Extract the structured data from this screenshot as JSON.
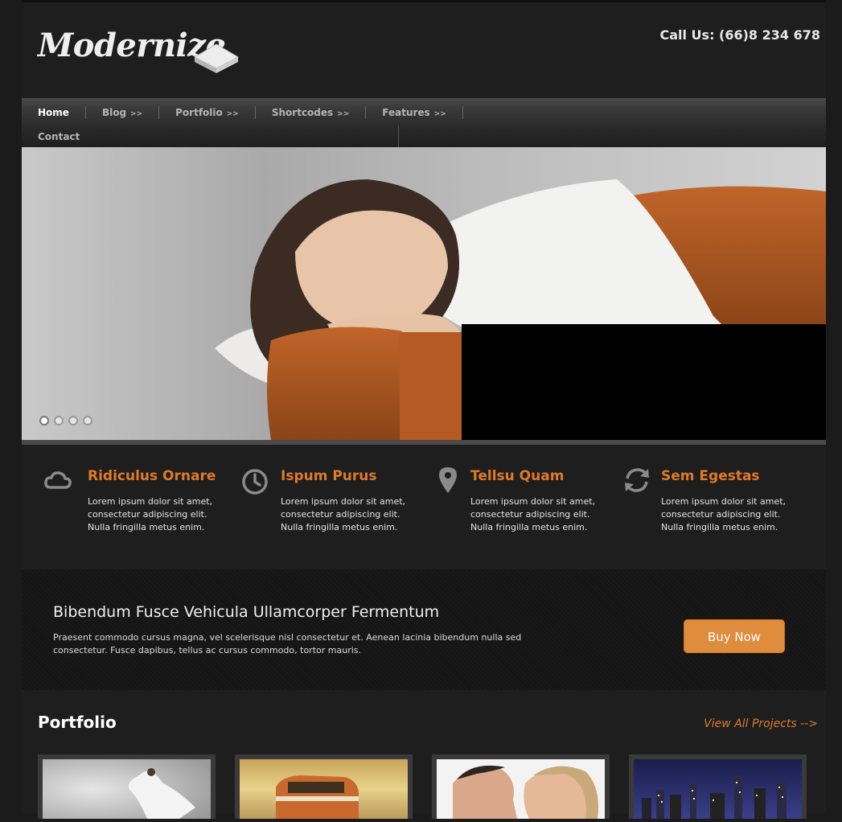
{
  "header": {
    "logo_text": "Modernize",
    "call_us": "Call Us: (66)8 234 678"
  },
  "nav": {
    "items": [
      {
        "label": "Home",
        "active": true,
        "has_submenu": false
      },
      {
        "label": "Blog",
        "active": false,
        "has_submenu": true
      },
      {
        "label": "Portfolio",
        "active": false,
        "has_submenu": true
      },
      {
        "label": "Shortcodes",
        "active": false,
        "has_submenu": true
      },
      {
        "label": "Features",
        "active": false,
        "has_submenu": true
      },
      {
        "label": "Contact",
        "active": false,
        "has_submenu": false
      }
    ],
    "submenu_marker": ">>"
  },
  "slider": {
    "dots": 4,
    "active_dot": 0
  },
  "features": [
    {
      "icon": "cloud-icon",
      "title": "Ridiculus Ornare",
      "text": "Lorem ipsum dolor sit amet, consectetur adipiscing elit. Nulla fringilla metus enim."
    },
    {
      "icon": "clock-icon",
      "title": "Ispum Purus",
      "text": "Lorem ipsum dolor sit amet, consectetur adipiscing elit. Nulla fringilla metus enim."
    },
    {
      "icon": "map-pin-icon",
      "title": "Tellsu Quam",
      "text": "Lorem ipsum dolor sit amet, consectetur adipiscing elit. Nulla fringilla metus enim."
    },
    {
      "icon": "refresh-icon",
      "title": "Sem Egestas",
      "text": "Lorem ipsum dolor sit amet, consectetur adipiscing elit. Nulla fringilla metus enim."
    }
  ],
  "promo": {
    "title": "Bibendum Fusce Vehicula Ullamcorper Fermentum",
    "text": "Praesent commodo cursus magna, vel scelerisque nisl consectetur et. Aenean lacinia bibendum nulla sed consectetur. Fusce dapibus, tellus ac cursus commodo, tortor mauris.",
    "button_label": "Buy Now"
  },
  "portfolio": {
    "title": "Portfolio",
    "view_all": "View All Projects -->",
    "thumbs": [
      "dancer-photo",
      "bus-photo",
      "couple-photo",
      "city-night-photo"
    ]
  },
  "colors": {
    "accent": "#e07a2a",
    "button": "#e08c3d",
    "background": "#1e1e1e"
  }
}
